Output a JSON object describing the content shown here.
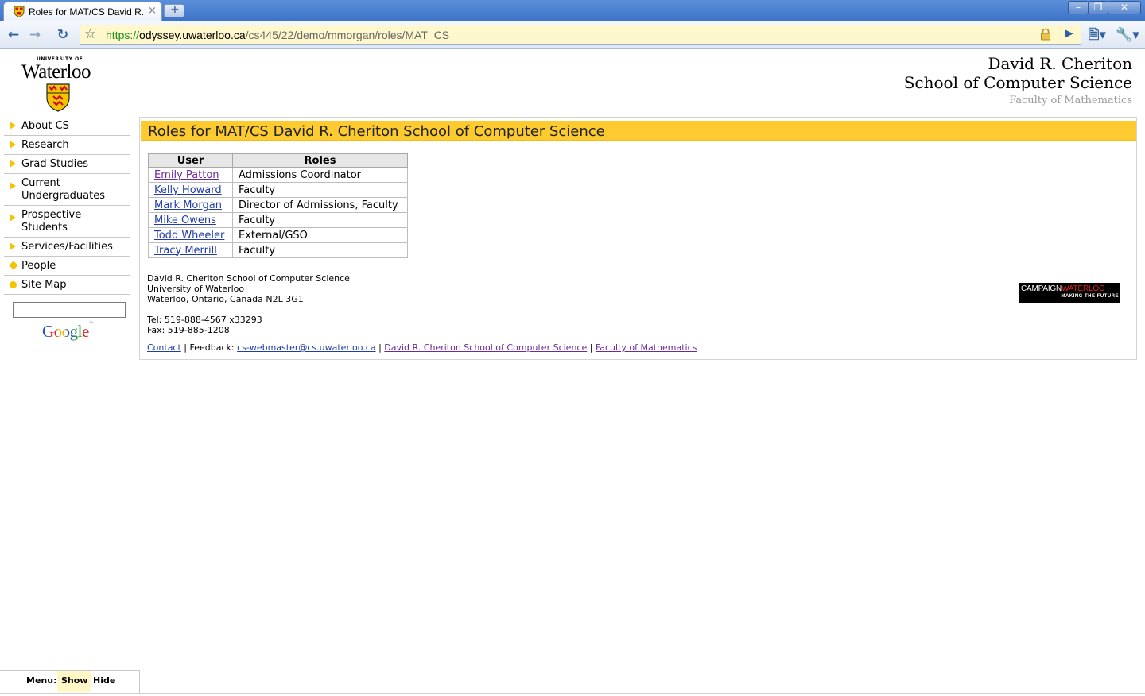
{
  "browser": {
    "tab_title": "Roles for MAT/CS David R. ...",
    "tab_close": "×",
    "new_tab": "+",
    "window_min": "–",
    "window_max": "❐",
    "window_close": "✕",
    "url_scheme": "https://",
    "url_host": "odyssey.uwaterloo.ca",
    "url_path": "/cs445/22/demo/mmorgan/roles/MAT_CS",
    "back_icon": "arrow-left-icon",
    "forward_icon": "arrow-right-icon",
    "reload_icon": "reload-icon",
    "bookmark_icon": "star-icon",
    "lock_icon": "lock-icon",
    "go_icon": "play-icon",
    "page_menu_icon": "page-icon",
    "tools_menu_icon": "wrench-icon"
  },
  "logo": {
    "university_of": "UNIVERSITY OF",
    "name": "Waterloo"
  },
  "header": {
    "line1": "David R. Cheriton",
    "line2": "School of Computer Science",
    "faculty": "Faculty of Mathematics"
  },
  "sidebar": {
    "items": [
      {
        "label": "About CS",
        "icon": "arrow"
      },
      {
        "label": "Research",
        "icon": "arrow"
      },
      {
        "label": "Grad Studies",
        "icon": "arrow"
      },
      {
        "label": "Current Undergraduates",
        "icon": "arrow"
      },
      {
        "label": "Prospective Students",
        "icon": "arrow"
      },
      {
        "label": "Services/Facilities",
        "icon": "arrow"
      },
      {
        "label": "People",
        "icon": "pin"
      },
      {
        "label": "Site Map",
        "icon": "dot"
      }
    ],
    "search_value": "",
    "google": "Google"
  },
  "content": {
    "title": "Roles for MAT/CS David R. Cheriton School of Computer Science",
    "table": {
      "headers": [
        "User",
        "Roles"
      ],
      "rows": [
        {
          "user": "Emily Patton",
          "roles": "Admissions Coordinator",
          "visited": true
        },
        {
          "user": "Kelly Howard",
          "roles": "Faculty",
          "visited": false
        },
        {
          "user": "Mark Morgan",
          "roles": "Director of Admissions, Faculty",
          "visited": false
        },
        {
          "user": "Mike Owens",
          "roles": "Faculty",
          "visited": false
        },
        {
          "user": "Todd Wheeler",
          "roles": "External/GSO",
          "visited": false
        },
        {
          "user": "Tracy Merrill",
          "roles": "Faculty",
          "visited": false
        }
      ]
    }
  },
  "footer": {
    "address": [
      "David R. Cheriton School of Computer Science",
      "University of Waterloo",
      "Waterloo, Ontario, Canada N2L 3G1"
    ],
    "tel": "Tel: 519-888-4567 x33293",
    "fax": "Fax: 519-885-1208",
    "contact": "Contact",
    "sep": " | ",
    "feedback_label": "Feedback: ",
    "email": "cs-webmaster@cs.uwaterloo.ca",
    "school_link": "David R. Cheriton School of Computer Science",
    "faculty_link": "Faculty of Mathematics",
    "campaign_a": "CAMPAIGN",
    "campaign_b": "WATERLOO",
    "campaign_tagline": "MAKING THE FUTURE"
  },
  "menu": {
    "label": "Menu:",
    "show": "Show",
    "hide": "Hide"
  },
  "colors": {
    "title_bar": "#fdcb2f",
    "link": "#1f3ca8",
    "visited_link": "#6b2a9c",
    "nav_icon": "#f5c400"
  }
}
